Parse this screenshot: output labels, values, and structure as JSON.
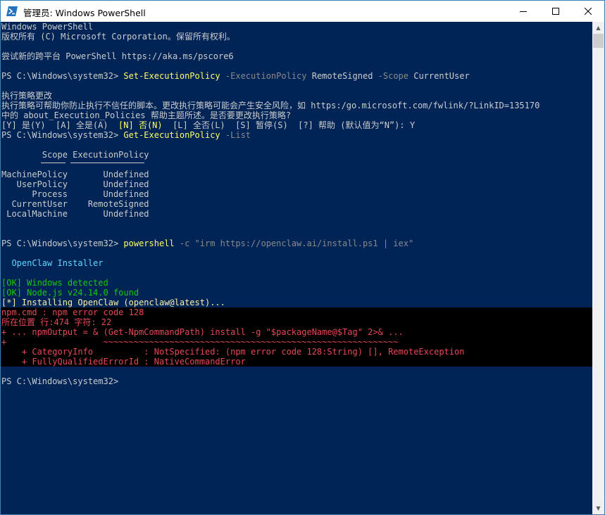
{
  "window": {
    "title": "管理员: Windows PowerShell"
  },
  "lines": {
    "l1": "Windows PowerShell",
    "l2": "版权所有 (C) Microsoft Corporation。保留所有权利。",
    "l3": "尝试新的跨平台 PowerShell https://aka.ms/pscore6",
    "prompt1": "PS C:\\Windows\\system32> ",
    "cmd1_a": "Set-ExecutionPolicy",
    "cmd1_b": " -ExecutionPolicy ",
    "cmd1_c": "RemoteSigned",
    "cmd1_d": " -Scope ",
    "cmd1_e": "CurrentUser",
    "policy_title": "执行策略更改",
    "policy_text1": "执行策略可帮助你防止执行不信任的脚本。更改执行策略可能会产生安全风险，如 https:/go.microsoft.com/fwlink/?LinkID=135170",
    "policy_text2": "中的 about_Execution_Policies 帮助主题所述。是否要更改执行策略?",
    "choice_a": "[Y] 是(Y)  [A] 全是(A)  ",
    "choice_b": "[N] 否(N)",
    "choice_c": "  [L] 全否(L)  [S] 暂停(S)  [?] 帮助 (默认值为“N”): Y",
    "prompt2": "PS C:\\Windows\\system32> ",
    "cmd2_a": "Get-ExecutionPolicy",
    "cmd2_b": " -List",
    "prompt3": "PS C:\\Windows\\system32> ",
    "cmd3_a": "powershell",
    "cmd3_b": " -c ",
    "cmd3_c": "\"irm https://openclaw.ai/install.ps1 | iex\"",
    "installer_title": "  OpenClaw Installer",
    "ok1": "[OK] Windows detected",
    "ok2": "[OK] Node.js v24.14.0 found",
    "installing": "[*] Installing OpenClaw (openclaw@latest)...",
    "err1": "npm.cmd : npm error code 128",
    "err2": "所在位置 行:474 字符: 22",
    "err3": "+ ... npmOutput = & (Get-NpmCommandPath) install -g \"$packageName@$Tag\" 2>& ...",
    "err4": "+                   ~~~~~~~~~~~~~~~~~~~~~~~~~~~~~~~~~~~~~~~~~~~~~~~~~~~~~~~~~~",
    "err5": "    + CategoryInfo          : NotSpecified: (npm error code 128:String) [], RemoteException",
    "err6": "    + FullyQualifiedErrorId : NativeCommandError",
    "prompt4": "PS C:\\Windows\\system32> "
  },
  "policy_table": {
    "headers": [
      "Scope",
      "ExecutionPolicy"
    ],
    "header_line": "        Scope ExecutionPolicy",
    "rows": [
      "MachinePolicy       Undefined",
      "   UserPolicy       Undefined",
      "      Process       Undefined",
      "  CurrentUser    RemoteSigned",
      " LocalMachine       Undefined"
    ]
  }
}
